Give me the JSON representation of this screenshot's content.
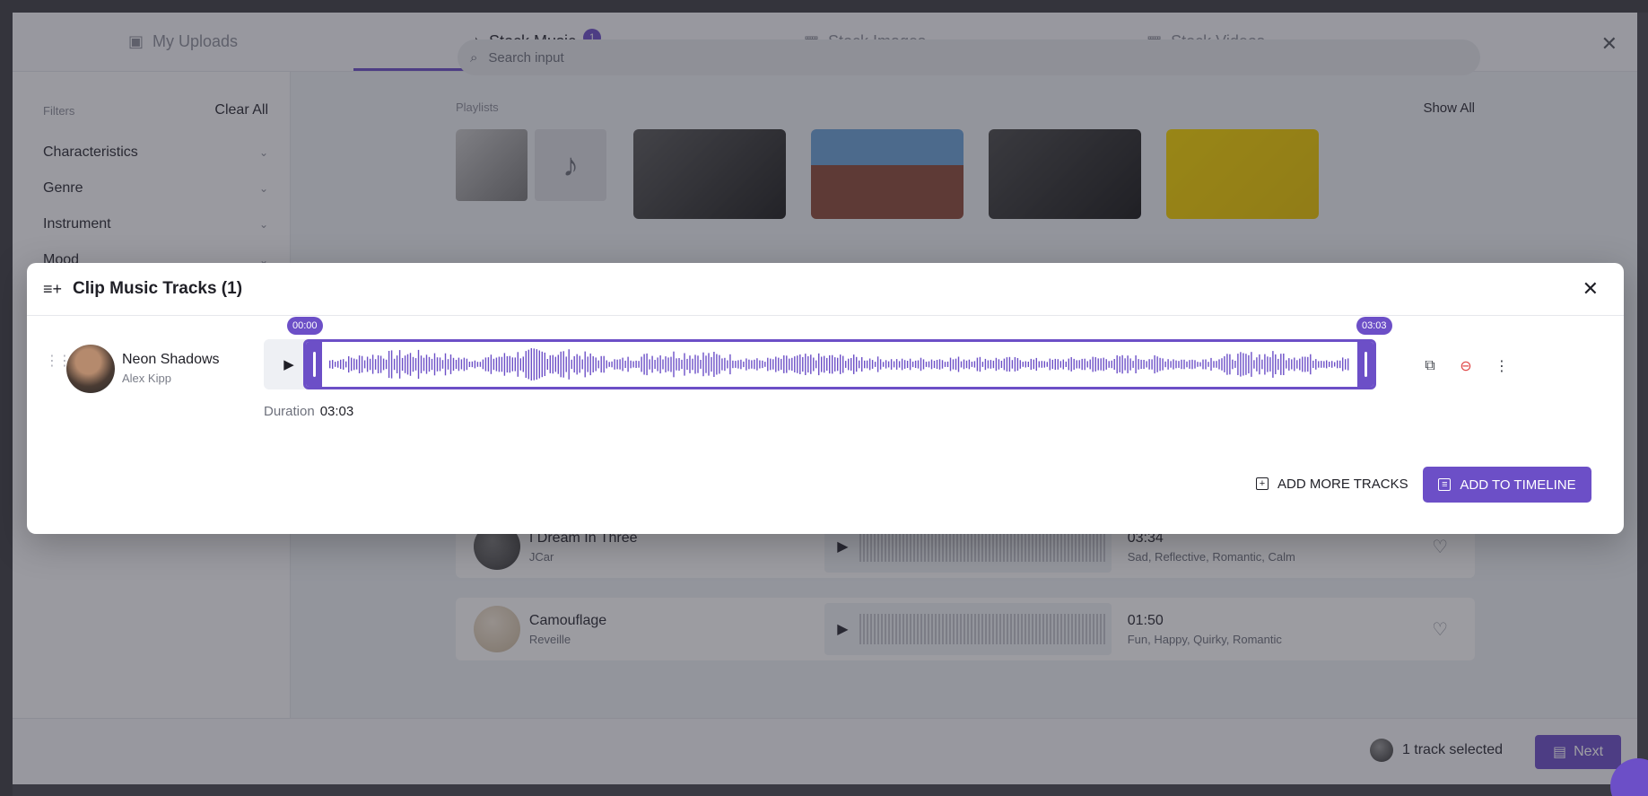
{
  "media": {
    "tabs": [
      {
        "label": "My Uploads",
        "icon": "upload-folder-icon"
      },
      {
        "label": "Stock Music",
        "icon": "music-note-icon",
        "badge": "1"
      },
      {
        "label": "Stock Images",
        "icon": "image-icon"
      },
      {
        "label": "Stock Videos",
        "icon": "video-icon"
      }
    ],
    "filters": {
      "heading": "Filters",
      "clear_label": "Clear All",
      "items": [
        "Characteristics",
        "Genre",
        "Instrument",
        "Mood"
      ]
    },
    "search": {
      "placeholder": "Search input"
    },
    "playlists": {
      "heading": "Playlists",
      "show_all": "Show All"
    },
    "tracks": [
      {
        "title": "I Dream In Three",
        "artist": "JCar",
        "duration": "03:34",
        "tags": "Sad, Reflective, Romantic, Calm"
      },
      {
        "title": "Camouflage",
        "artist": "Reveille",
        "duration": "01:50",
        "tags": "Fun, Happy, Quirky, Romantic"
      }
    ],
    "footer": {
      "selected_text": "1 track selected",
      "next_label": "Next"
    }
  },
  "dialog": {
    "title": "Clip Music Tracks (1)",
    "track": {
      "title": "Neon Shadows",
      "artist": "Alex Kipp"
    },
    "clip": {
      "start": "00:00",
      "end": "03:03"
    },
    "duration_label": "Duration",
    "duration_value": "03:03",
    "add_more_label": "ADD MORE TRACKS",
    "add_timeline_label": "ADD TO TIMELINE"
  },
  "colors": {
    "accent": "#6c4fc7",
    "danger": "#e04848"
  }
}
